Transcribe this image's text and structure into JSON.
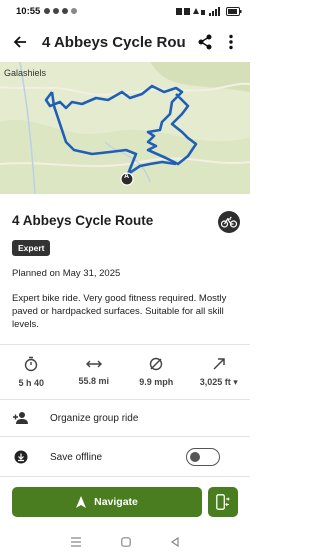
{
  "status": {
    "time": "10:55",
    "battery_icon": "battery-icon",
    "wifi_icon": "wifi-icon"
  },
  "appbar": {
    "title": "4 Abbeys Cycle Rou",
    "back_icon": "arrow-left-icon",
    "share_icon": "share-icon",
    "more_icon": "more-vert-icon"
  },
  "map": {
    "town_label": "Galashiels",
    "start_marker": "A"
  },
  "route": {
    "title": "4 Abbeys Cycle Route",
    "sport_icon": "bicycle-icon",
    "difficulty": "Expert",
    "planned": "Planned on May 31, 2025",
    "description": "Expert bike ride. Very good fitness required. Mostly paved or hardpacked surfaces. Suitable for all skill levels."
  },
  "stats": [
    {
      "icon": "stopwatch-icon",
      "value": "5 h 40"
    },
    {
      "icon": "distance-arrows-icon",
      "value": "55.8 mi"
    },
    {
      "icon": "speed-icon",
      "value": "9.9 mph"
    },
    {
      "icon": "elevation-icon",
      "value": "3,025 ft ▾"
    }
  ],
  "actions": {
    "group_ride": "Organize group ride",
    "save_offline": "Save offline",
    "save_offline_on": false
  },
  "footer": {
    "navigate": "Navigate"
  },
  "colors": {
    "accent": "#4a7d1f",
    "route_line": "#1f5fb8"
  }
}
